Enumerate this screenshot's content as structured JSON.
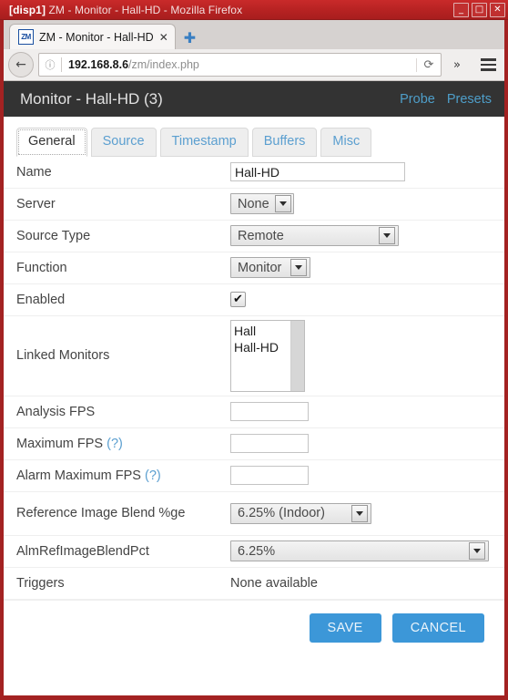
{
  "window": {
    "title_prefix": "[disp1]",
    "title": "ZM - Monitor - Hall-HD - Mozilla Firefox",
    "minimize_icon": "_",
    "maximize_icon": "□",
    "close_icon": "✕"
  },
  "browser": {
    "tab": {
      "favicon_text": "ZM",
      "title": "ZM - Monitor - Hall-HD",
      "close_icon": "✕"
    },
    "new_tab_icon": "✚",
    "back_icon": "←",
    "url": {
      "info_icon": "ⓘ",
      "host": "192.168.8.6",
      "path": "/zm/index.php",
      "reload_icon": "⟳"
    },
    "overflow_icon": "»",
    "menu_icon": "hamburger-icon"
  },
  "zm": {
    "header": {
      "title": "Monitor - Hall-HD (3)",
      "links": [
        "Probe",
        "Presets"
      ]
    },
    "tabs": [
      {
        "label": "General",
        "active": true
      },
      {
        "label": "Source",
        "active": false
      },
      {
        "label": "Timestamp",
        "active": false
      },
      {
        "label": "Buffers",
        "active": false
      },
      {
        "label": "Misc",
        "active": false
      }
    ],
    "fields": {
      "name": {
        "label": "Name",
        "value": "Hall-HD"
      },
      "server": {
        "label": "Server",
        "value": "None"
      },
      "source_type": {
        "label": "Source Type",
        "value": "Remote"
      },
      "function": {
        "label": "Function",
        "value": "Monitor"
      },
      "enabled": {
        "label": "Enabled",
        "checked": true,
        "check_icon": "✔"
      },
      "linked_monitors": {
        "label": "Linked Monitors",
        "options": [
          "Hall",
          "Hall-HD"
        ]
      },
      "analysis_fps": {
        "label": "Analysis FPS",
        "value": ""
      },
      "maximum_fps": {
        "label": "Maximum FPS",
        "help": "(?)",
        "value": ""
      },
      "alarm_maximum_fps": {
        "label": "Alarm Maximum FPS",
        "help": "(?)",
        "value": ""
      },
      "ref_image_blend": {
        "label": "Reference Image Blend %ge",
        "value": "6.25% (Indoor)"
      },
      "alm_ref_image_blend_pct": {
        "label": "AlmRefImageBlendPct",
        "value": "6.25%"
      },
      "triggers": {
        "label": "Triggers",
        "value": "None available"
      }
    },
    "buttons": {
      "save": "SAVE",
      "cancel": "CANCEL"
    }
  },
  "colors": {
    "window_frame": "#a32222",
    "zm_header_bg": "#333333",
    "accent_link": "#4e9ec9",
    "button_blue": "#3c97d8"
  }
}
